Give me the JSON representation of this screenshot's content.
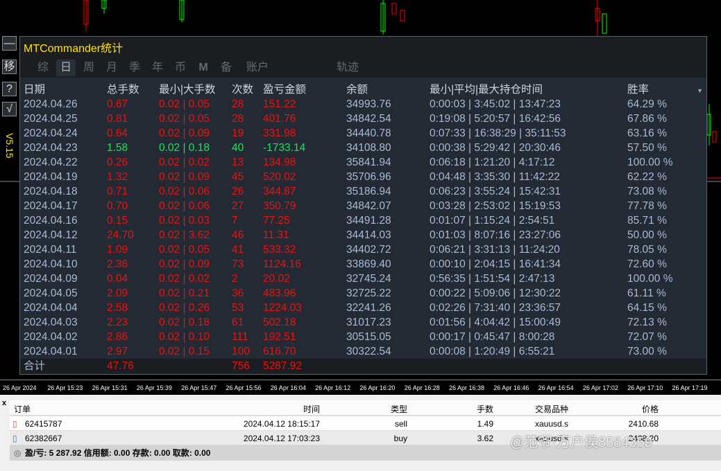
{
  "panel": {
    "title": "MTCommander统计",
    "version": "V5.15"
  },
  "side_buttons": [
    "—",
    "移",
    "?",
    "√"
  ],
  "tabs": [
    "综",
    "日",
    "周",
    "月",
    "季",
    "年",
    "币",
    "M",
    "备",
    "账户",
    "轨迹"
  ],
  "active_tab": "日",
  "columns": [
    "日期",
    "总手数",
    "最小|大手数",
    "次数",
    "盈亏金额",
    "余额",
    "最小|平均|最大持仓时间",
    "胜率"
  ],
  "rows": [
    {
      "date": "2024.04.26",
      "lots": "0.67",
      "minmax": "0.02 | 0.05",
      "count": "28",
      "pnl": "151.22",
      "balance": "34993.76",
      "hold": "0:00:03 | 3:45:02 | 13:47:23",
      "win": "64.29 %",
      "color": "red"
    },
    {
      "date": "2024.04.25",
      "lots": "0.81",
      "minmax": "0.02 | 0.05",
      "count": "28",
      "pnl": "401.76",
      "balance": "34842.54",
      "hold": "0:19:08 | 5:20:57 | 16:42:56",
      "win": "67.86 %",
      "color": "red"
    },
    {
      "date": "2024.04.24",
      "lots": "0.64",
      "minmax": "0.02 | 0.09",
      "count": "19",
      "pnl": "331.98",
      "balance": "34440.78",
      "hold": "0:07:33 | 16:38:29 | 35:11:53",
      "win": "63.16 %",
      "color": "red"
    },
    {
      "date": "2024.04.23",
      "lots": "1.58",
      "minmax": "0.02 | 0.18",
      "count": "40",
      "pnl": "-1733.14",
      "balance": "34108.80",
      "hold": "0:00:38 | 5:29:42 | 20:30:46",
      "win": "57.50 %",
      "color": "grn"
    },
    {
      "date": "2024.04.22",
      "lots": "0.26",
      "minmax": "0.02 | 0.02",
      "count": "13",
      "pnl": "134.98",
      "balance": "35841.94",
      "hold": "0:06:18 | 1:21:20 | 4:17:12",
      "win": "100.00 %",
      "color": "red"
    },
    {
      "date": "2024.04.19",
      "lots": "1.32",
      "minmax": "0.02 | 0.09",
      "count": "45",
      "pnl": "520.02",
      "balance": "35706.96",
      "hold": "0:04:48 | 3:35:30 | 11:42:22",
      "win": "62.22 %",
      "color": "red"
    },
    {
      "date": "2024.04.18",
      "lots": "0.71",
      "minmax": "0.02 | 0.06",
      "count": "26",
      "pnl": "344.87",
      "balance": "35186.94",
      "hold": "0:06:23 | 3:55:24 | 15:42:31",
      "win": "73.08 %",
      "color": "red"
    },
    {
      "date": "2024.04.17",
      "lots": "0.70",
      "minmax": "0.02 | 0.06",
      "count": "27",
      "pnl": "350.79",
      "balance": "34842.07",
      "hold": "0:03:28 | 2:53:02 | 15:19:53",
      "win": "77.78 %",
      "color": "red"
    },
    {
      "date": "2024.04.16",
      "lots": "0.15",
      "minmax": "0.02 | 0.03",
      "count": "7",
      "pnl": "77.25",
      "balance": "34491.28",
      "hold": "0:01:07 | 1:15:24 | 2:54:51",
      "win": "85.71 %",
      "color": "red"
    },
    {
      "date": "2024.04.12",
      "lots": "24.70",
      "minmax": "0.02 | 3.62",
      "count": "46",
      "pnl": "11.31",
      "balance": "34414.03",
      "hold": "0:01:03 | 8:07:16 | 23:27:06",
      "win": "50.00 %",
      "color": "red"
    },
    {
      "date": "2024.04.11",
      "lots": "1.09",
      "minmax": "0.02 | 0.05",
      "count": "41",
      "pnl": "533.32",
      "balance": "34402.72",
      "hold": "0:06:21 | 3:31:13 | 11:24:20",
      "win": "78.05 %",
      "color": "red"
    },
    {
      "date": "2024.04.10",
      "lots": "2.36",
      "minmax": "0.02 | 0.09",
      "count": "73",
      "pnl": "1124.16",
      "balance": "33869.40",
      "hold": "0:00:10 | 2:04:15 | 16:41:34",
      "win": "72.60 %",
      "color": "red"
    },
    {
      "date": "2024.04.09",
      "lots": "0.04",
      "minmax": "0.02 | 0.02",
      "count": "2",
      "pnl": "20.02",
      "balance": "32745.24",
      "hold": "0:56:35 | 1:51:54 | 2:47:13",
      "win": "100.00 %",
      "color": "red"
    },
    {
      "date": "2024.04.05",
      "lots": "2.09",
      "minmax": "0.02 | 0.21",
      "count": "36",
      "pnl": "483.96",
      "balance": "32725.22",
      "hold": "0:00:22 | 5:09:06 | 12:30:22",
      "win": "61.11 %",
      "color": "red"
    },
    {
      "date": "2024.04.04",
      "lots": "2.58",
      "minmax": "0.02 | 0.26",
      "count": "53",
      "pnl": "1224.03",
      "balance": "32241.26",
      "hold": "0:02:26 | 7:31:40 | 23:36:57",
      "win": "64.15 %",
      "color": "red"
    },
    {
      "date": "2024.04.03",
      "lots": "2.23",
      "minmax": "0.02 | 0.18",
      "count": "61",
      "pnl": "502.18",
      "balance": "31017.23",
      "hold": "0:01:56 | 4:04:42 | 15:00:49",
      "win": "72.13 %",
      "color": "red"
    },
    {
      "date": "2024.04.02",
      "lots": "2.86",
      "minmax": "0.02 | 0.10",
      "count": "111",
      "pnl": "192.51",
      "balance": "30515.05",
      "hold": "0:00:17 | 0:45:47 | 8:00:28",
      "win": "72.07 %",
      "color": "red"
    },
    {
      "date": "2024.04.01",
      "lots": "2.97",
      "minmax": "0.02 | 0.15",
      "count": "100",
      "pnl": "616.70",
      "balance": "30322.54",
      "hold": "0:00:08 | 1:20:49 | 6:55:21",
      "win": "73.00 %",
      "color": "red"
    }
  ],
  "total": {
    "label": "合计",
    "lots": "47.76",
    "count": "756",
    "pnl": "5287.92"
  },
  "time_axis": [
    "26 Apr 2024",
    "26 Apr 15:23",
    "26 Apr 15:31",
    "26 Apr 15:39",
    "26 Apr 15:47",
    "26 Apr 15:56",
    "26 Apr 16:04",
    "26 Apr 16:12",
    "26 Apr 16:20",
    "26 Apr 16:28",
    "26 Apr 16:38",
    "26 Apr 16:46",
    "26 Apr 16:54",
    "26 Apr 17:02",
    "26 Apr 17:10",
    "26 Apr 17:19"
  ],
  "orders": {
    "columns": [
      "订单",
      "时间",
      "类型",
      "手数",
      "交易品种",
      "价格"
    ],
    "rows": [
      {
        "order": "62415787",
        "time": "2024.04.12 18:15:17",
        "type": "sell",
        "lots": "1.49",
        "symbol": "xauusd.s",
        "price": "2410.68"
      },
      {
        "order": "62382667",
        "time": "2024.04.12 17:03:23",
        "type": "buy",
        "lots": "3.62",
        "symbol": "xauusd.s",
        "price": "2408.20"
      }
    ]
  },
  "status_bar": "盈/亏: 5 287.92  信用额: 0.00  存款: 0.00  取款: 0.00",
  "watermark": "@范爷·万户侯8584359",
  "colors": {
    "profit": "#ee1111",
    "loss": "#16e85a",
    "title": "#ffe600"
  }
}
